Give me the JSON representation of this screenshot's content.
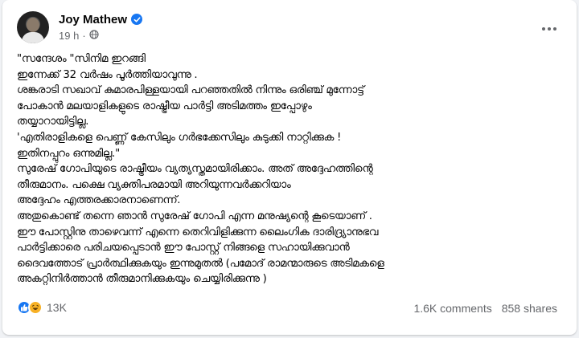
{
  "post": {
    "author": "Joy Mathew",
    "time": "19 h",
    "dot": "·",
    "verified_icon": "verified-badge-icon",
    "audience_icon": "globe-icon",
    "body_lines": [
      "\"സന്ദേശം \"സിനിമ ഇറങ്ങി",
      "ഇന്നേക്ക് 32 വർഷം പൂർത്തിയാവുന്നു .",
      "ശങ്കരാടി സഖാവ് കുമാരപിള്ളയായി പറഞ്ഞതിൽ നിന്നും ഒരിഞ്ച് മുന്നോട്ട്",
      "പോകാൻ മലയാളികളുടെ രാഷ്ട്രീയ പാർട്ടി അടിമത്തം ഇപ്പോഴും",
      "തയ്യാറായിട്ടില്ല.",
      "'എതിരാളികളെ പെണ്ണ് കേസിലും ഗർഭക്കേസിലും കുടുക്കി നാറ്റിക്കുക !",
      "ഇതിനപ്പുറം ഒന്നുമില്ല.\"",
      "സുരേഷ് ഗോപിയുടെ രാഷ്ട്രീയം വ്യത്യസ്തമായിരിക്കാം. അത് അദ്ദേഹത്തിന്റെ",
      "തീരുമാനം. പക്ഷെ വ്യക്തിപരമായി അറിയുന്നവർക്കറിയാം",
      "അദ്ദേഹം എത്തരക്കാരനാണെന്ന്.",
      "അതുകൊണ്ട് തന്നെ ഞാൻ സുരേഷ് ഗോപി എന്ന മനുഷ്യന്റെ കൂടെയാണ് .",
      "ഈ പോസ്റ്റിനു താഴെവന്ന് എന്നെ തെറിവിളിക്കുന്ന ലൈംഗിക ദാരിദ്ര്യാനുഭവ",
      "പാർട്ടിക്കാരെ പരിചയപ്പെടാൻ ഈ പോസ്റ്റ് നിങ്ങളെ സഹായിക്കുവാൻ",
      "ദൈവത്തോട് പ്രാർത്ഥിക്കുകയും ഇന്നുമുതൽ (പമോദ് രാമന്മാരുടെ അടിമകളെ",
      "അകറ്റിനിർത്താൻ തീരുമാനിക്കുകയും ചെയ്യിരിക്കുന്നു )"
    ]
  },
  "footer": {
    "reaction_icons": [
      "like-reaction-icon",
      "haha-reaction-icon"
    ],
    "reaction_count": "13K",
    "comments": "1.6K comments",
    "shares": "858 shares"
  },
  "colors": {
    "accent": "#1877f2",
    "secondary_text": "#65676b",
    "haha": "#f7b125"
  }
}
